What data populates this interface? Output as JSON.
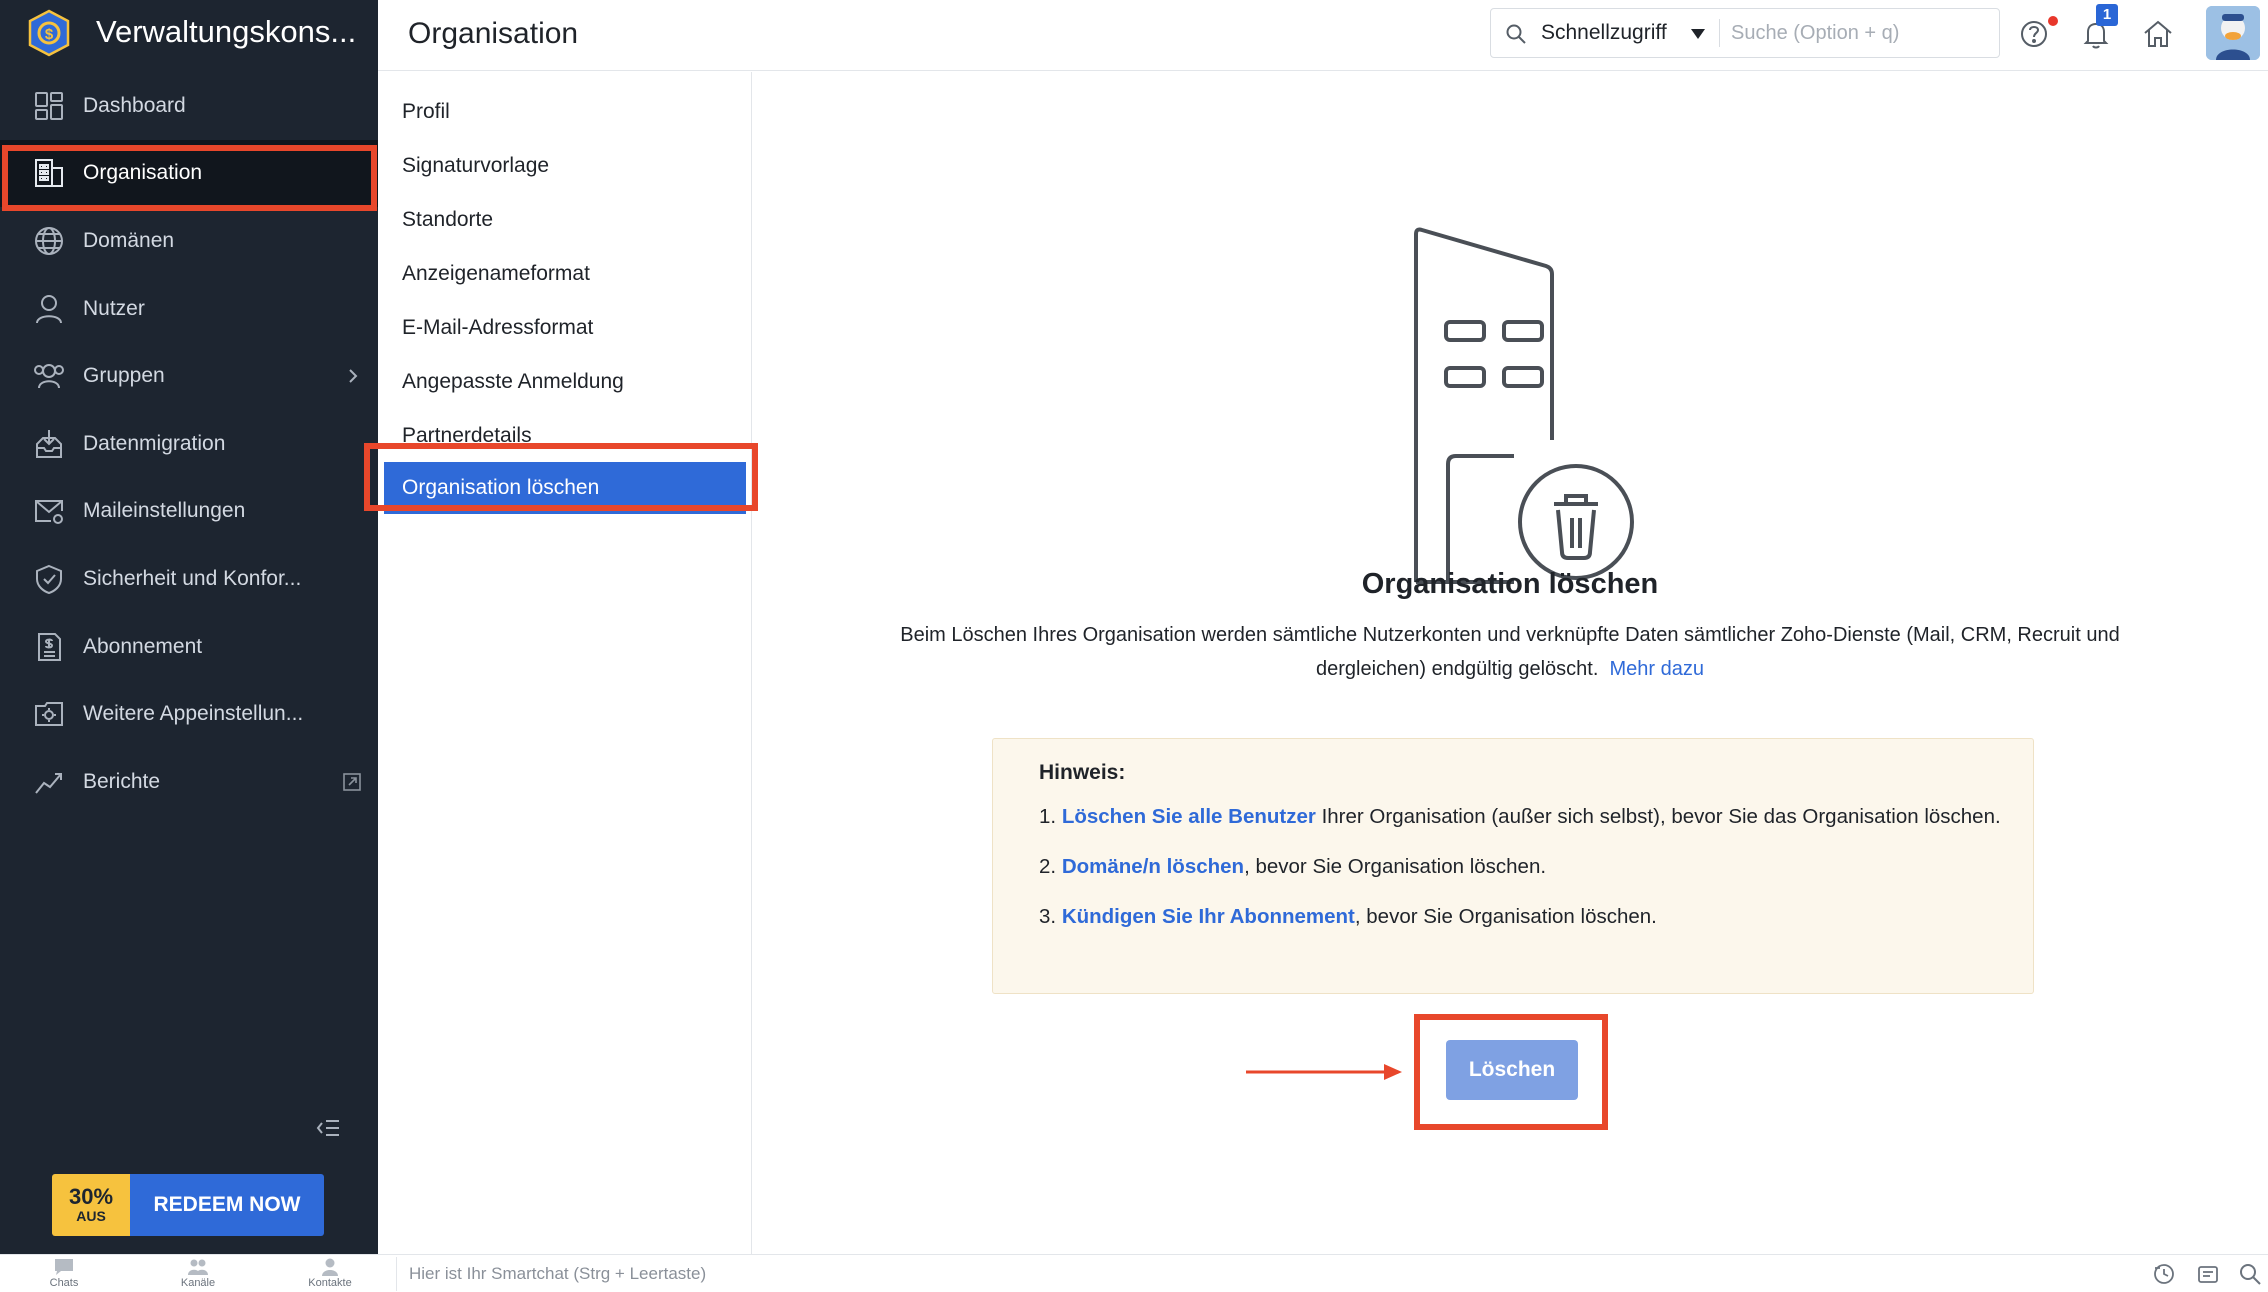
{
  "app": {
    "title": "Verwaltungskons...",
    "colors": {
      "sidebar": "#1d2530",
      "accent": "#2f6ad8",
      "highlight": "#e8472b",
      "note_bg": "#fcf7ec"
    }
  },
  "sidebar": {
    "items": [
      {
        "label": "Dashboard",
        "icon": "dashboard-icon"
      },
      {
        "label": "Organisation",
        "icon": "building-icon"
      },
      {
        "label": "Domänen",
        "icon": "globe-icon"
      },
      {
        "label": "Nutzer",
        "icon": "user-icon"
      },
      {
        "label": "Gruppen",
        "icon": "users-icon"
      },
      {
        "label": "Datenmigration",
        "icon": "migration-icon"
      },
      {
        "label": "Maileinstellungen",
        "icon": "mail-settings-icon"
      },
      {
        "label": "Sicherheit und Konfor...",
        "icon": "shield-icon"
      },
      {
        "label": "Abonnement",
        "icon": "invoice-icon"
      },
      {
        "label": "Weitere Appeinstellun...",
        "icon": "app-settings-icon"
      },
      {
        "label": "Berichte",
        "icon": "chart-icon"
      }
    ],
    "promo": {
      "percent": "30%",
      "off": "AUS",
      "cta": "REDEEM NOW"
    }
  },
  "header": {
    "title": "Organisation",
    "quick_access": "Schnellzugriff",
    "search_placeholder": "Suche (Option + q)",
    "notification_count": "1"
  },
  "subnav": {
    "items": [
      "Profil",
      "Signaturvorlage",
      "Standorte",
      "Anzeigenameformat",
      "E-Mail-Adressformat",
      "Angepasste Anmeldung",
      "Partnerdetails",
      "Organisation löschen"
    ]
  },
  "main": {
    "title": "Organisation löschen",
    "description": "Beim Löschen Ihres Organisation werden sämtliche Nutzerkonten und verknüpfte Daten sämtlicher Zoho-Dienste (Mail, CRM, Recruit und dergleichen) endgültig gelöscht.",
    "more_link": "Mehr dazu",
    "note": {
      "title": "Hinweis:",
      "items": [
        {
          "num": "1.",
          "link": "Löschen Sie alle Benutzer",
          "text": " Ihrer Organisation (außer sich selbst), bevor Sie das Organisation löschen."
        },
        {
          "num": "2.",
          "link": "Domäne/n löschen",
          "text": ", bevor Sie Organisation löschen."
        },
        {
          "num": "3.",
          "link": "Kündigen Sie Ihr Abonnement",
          "text": ", bevor Sie Organisation löschen."
        }
      ]
    },
    "delete_button": "Löschen"
  },
  "bottombar": {
    "tabs": [
      "Chats",
      "Kanäle",
      "Kontakte"
    ],
    "smartchat_placeholder": "Hier ist Ihr Smartchat (Strg + Leertaste)"
  }
}
